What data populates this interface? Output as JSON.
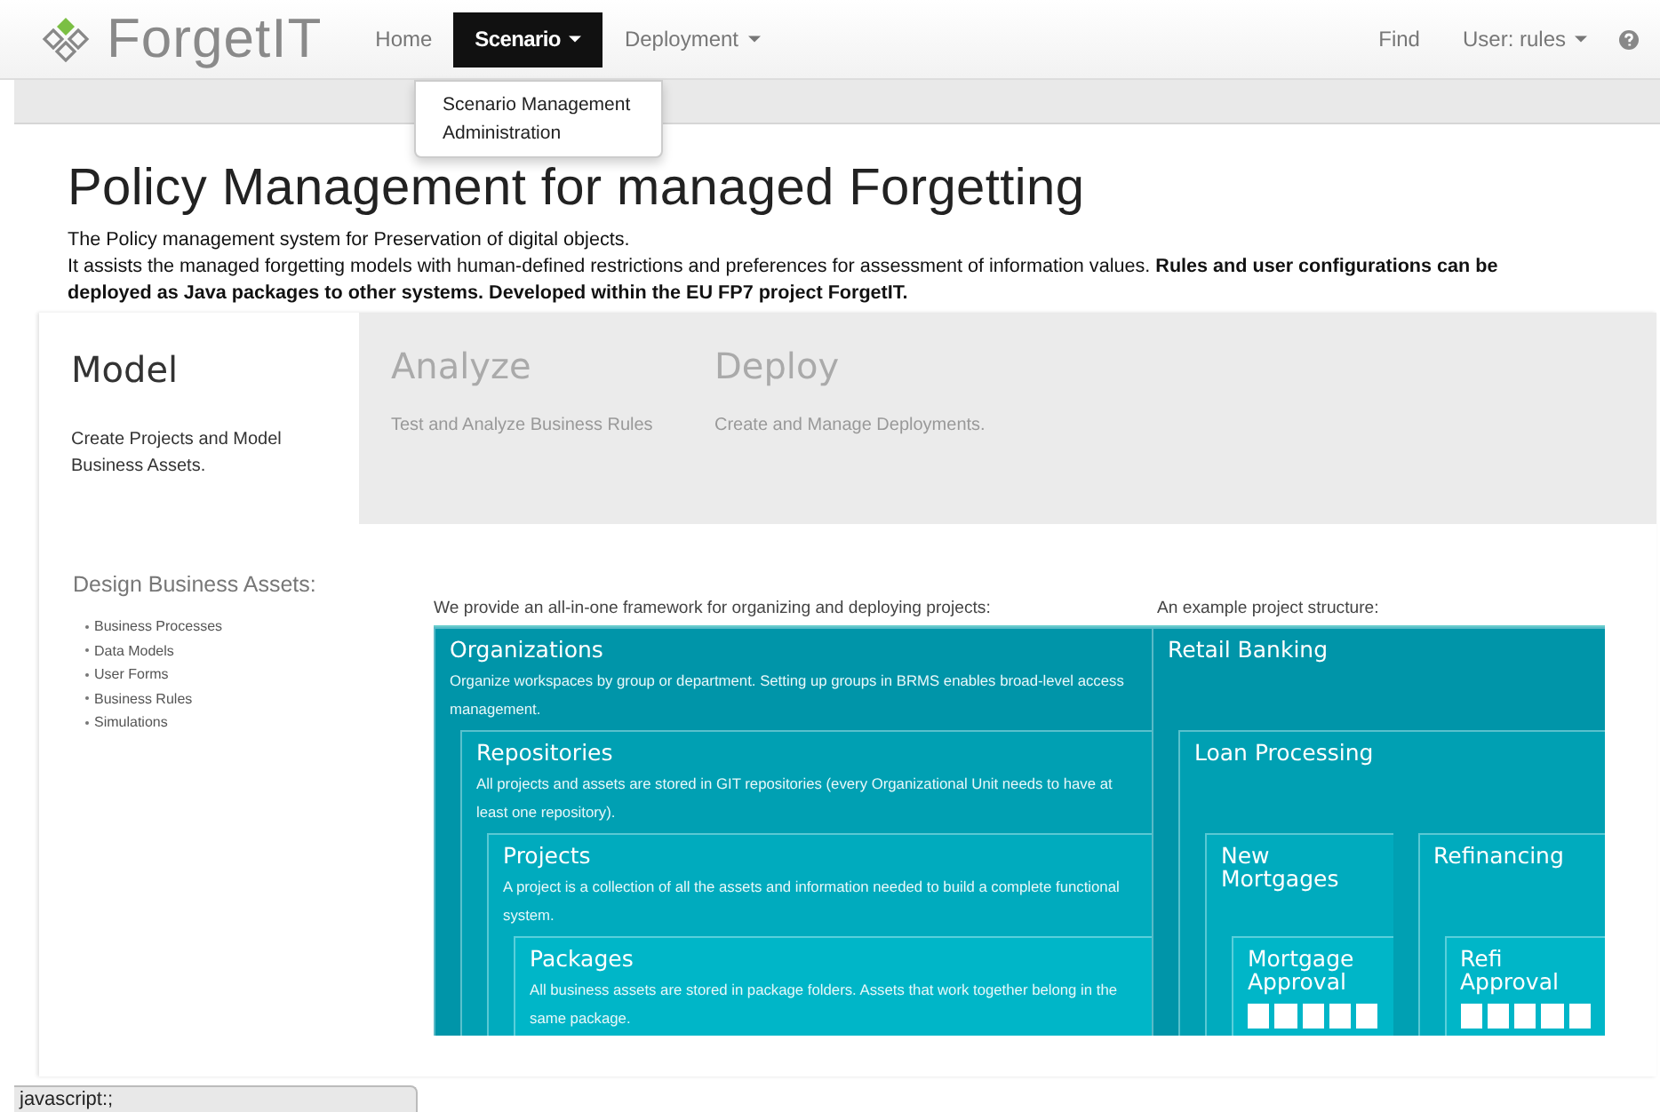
{
  "navbar": {
    "brand": "ForgetIT",
    "items": [
      {
        "label": "Home",
        "selected": false,
        "dropdown": false
      },
      {
        "label": "Scenario",
        "selected": true,
        "dropdown": true
      },
      {
        "label": "Deployment",
        "selected": false,
        "dropdown": true
      }
    ],
    "right_items": [
      {
        "label": "Find",
        "dropdown": false
      },
      {
        "label": "User: rules",
        "dropdown": true
      }
    ]
  },
  "dropdown_menu": [
    "Scenario Management",
    "Administration"
  ],
  "heading": "Policy Management for managed Forgetting",
  "intro": [
    "The Policy management system for Preservation of digital objects.",
    "It assists the managed forgetting models with human-defined restrictions and preferences for assessment of information values. **Rules and user configurations can be deployed as Java packages to other systems. Developed within the EU FP7 project ForgetIT.**"
  ],
  "tabs": [
    {
      "title": "Model",
      "description": "Create Projects and Model Business Assets.",
      "selected": true
    },
    {
      "title": "Analyze",
      "description": "Test and Analyze Business Rules",
      "selected": false
    },
    {
      "title": "Deploy",
      "description": "Create and Manage Deployments.",
      "selected": false
    }
  ],
  "sidebar": {
    "title": "Design Business Assets:",
    "items": [
      "Business Processes",
      "Data Models",
      "User Forms",
      "Business Rules",
      "Simulations"
    ]
  },
  "framework": {
    "caption": "We provide an all-in-one framework for organizing and deploying projects:",
    "box": {
      "title": "Organizations",
      "description": "Organize workspaces by group or department. Setting up groups in BRMS enables broad-level access management.",
      "children": [
        {
          "title": "Repositories",
          "description": "All projects and assets are stored in GIT repositories (every Organizational Unit needs to have at least one repository).",
          "children": [
            {
              "title": "Projects",
              "description": "A project is a collection of all the assets and information needed to build a complete functional system.",
              "children": [
                {
                  "title": "Packages",
                  "description": "All business assets are stored in package folders.  Assets that work together belong in the same package."
                }
              ]
            }
          ]
        }
      ]
    }
  },
  "example": {
    "caption": "An example project structure:",
    "box": {
      "title": "Retail Banking",
      "children": [
        {
          "title": "Loan Processing",
          "children": [
            {
              "title": "New Mortgages",
              "children": [
                {
                  "title": "Mortgage Approval",
                  "kind": "workflow"
                }
              ]
            },
            {
              "title": "Refinancing",
              "children": [
                {
                  "title": "Refi Approval",
                  "kind": "workflow"
                }
              ]
            }
          ]
        }
      ]
    }
  },
  "status_bar": "javascript:;"
}
